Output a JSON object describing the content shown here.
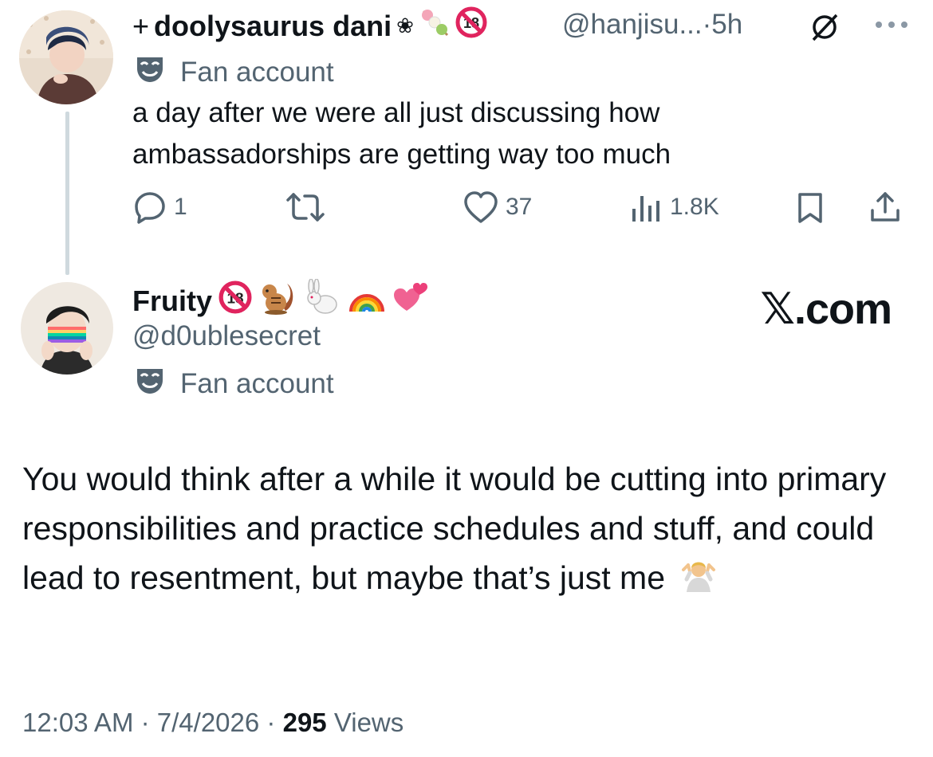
{
  "post1": {
    "display_name": "doolysaurus dani",
    "name_prefix": "+",
    "name_suffix": "❀",
    "handle": "@hanjisu...",
    "separator": "·",
    "time": "5h",
    "label": "Fan account",
    "text": "a day after we were all just discussing how ambassadorships are getting way too much",
    "actions": {
      "replies": "1",
      "reposts": "",
      "likes": "37",
      "views": "1.8K"
    }
  },
  "post2": {
    "display_name": "Fruity",
    "handle": "@d0ublesecret",
    "label": "Fan account",
    "watermark": "𝕏.com",
    "text": "You would think after a while it would be cutting into primary responsibilities and practice schedules and stuff, and could lead to resentment, but maybe that’s just me",
    "time": "12:03 AM",
    "date": "7/4/2026",
    "views_count": "295",
    "views_label": "Views",
    "separator": "·"
  },
  "colors": {
    "text": "#0f1419",
    "secondary": "#536471",
    "thread_line": "#cfd9de"
  },
  "icons": [
    "reply-icon",
    "repost-icon",
    "like-icon",
    "views-icon",
    "bookmark-icon",
    "share-icon",
    "grok-icon",
    "more-icon",
    "mask-icon",
    "no-under-18-icon"
  ]
}
